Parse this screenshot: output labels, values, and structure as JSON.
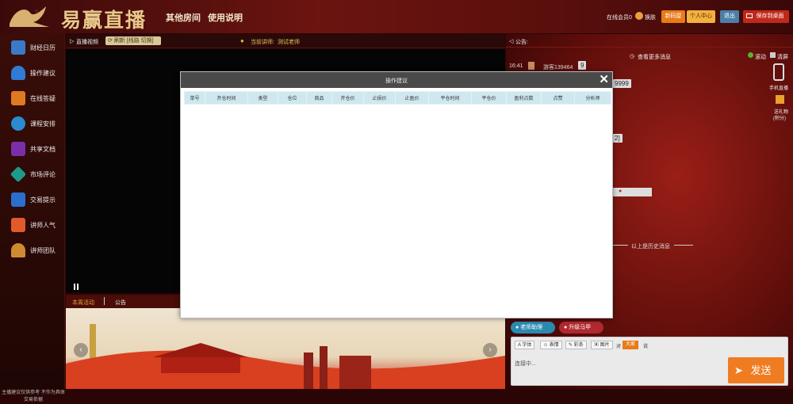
{
  "header": {
    "brand": "易赢直播",
    "nav": [
      "其他房间",
      "使用说明"
    ],
    "online_label": "在线会员0",
    "skin_label": "换肤",
    "register_label": "新码屋",
    "user_center_label": "个人中心",
    "logout_label": "退出",
    "save_desktop_label": "保存到桌面"
  },
  "sidebar": {
    "items": [
      {
        "label": "财经日历",
        "color": "#3b7ac8"
      },
      {
        "label": "操作建议",
        "color": "#2f7bd6"
      },
      {
        "label": "在线答疑",
        "color": "#e07a20"
      },
      {
        "label": "课程安排",
        "color": "#2a8bd0"
      },
      {
        "label": "共享文档",
        "color": "#7a2fa8"
      },
      {
        "label": "市场评论",
        "color": "#1e9a8a"
      },
      {
        "label": "交易提示",
        "color": "#2a6fd0"
      },
      {
        "label": "讲师人气",
        "color": "#e05a2a"
      },
      {
        "label": "讲师团队",
        "color": "#d08a30"
      }
    ],
    "disclaimer": "主播建议仅供参考 不作为具体交易依据"
  },
  "video": {
    "live_label": "直播视频",
    "refresh_label": "刷新",
    "switch_label": "[线路 切换]",
    "lecturer_prefix": "当前讲师:",
    "lecturer_name": "测试老师"
  },
  "bottom_tabs": {
    "active": "本周活动",
    "notice": "公告"
  },
  "right_panel": {
    "notice_label": "公告:",
    "more_messages": "查看更多消息",
    "scroll_label": "滚动",
    "clear_label": "清屏",
    "msg_time": "16:41",
    "msg_user": "游客139464",
    "msg_badge": "9",
    "fragment_9999": "9999",
    "fragment_bracket": "2]",
    "history_label": "以上是历史消息",
    "mobile_label": "手机直播",
    "gift_label": "送礼物",
    "gift_points": "(积分)"
  },
  "modal": {
    "title": "操作建议",
    "close": "✕",
    "columns": [
      "单号",
      "开仓时间",
      "类型",
      "仓位",
      "商品",
      "开仓价",
      "止损价",
      "止盈价",
      "平仓时间",
      "平仓价",
      "盈利点数",
      "点赞",
      "分析师"
    ]
  },
  "chat": {
    "tab_teacher": "老师助理",
    "tab_upgrade": "升级马甲",
    "tools": [
      "字体",
      "表情",
      "彩条",
      "图片"
    ],
    "to_label": "对",
    "target": "大家",
    "say_label": "说",
    "placeholder": "连接中...",
    "send_label": "发送"
  },
  "colors": {
    "accent": "#f07c22",
    "modal_header": "#4a4a4a",
    "table_header": "#cfe8f0"
  }
}
